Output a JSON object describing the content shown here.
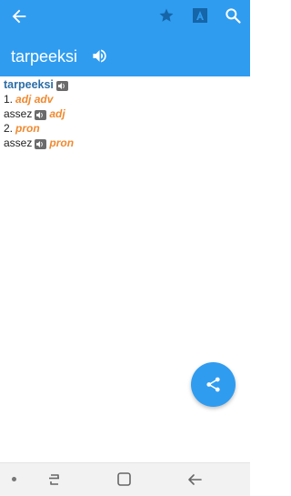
{
  "app": {
    "title": "tarpeeksi",
    "icons": {
      "back": "arrow-left-icon",
      "favorite": "star-icon",
      "font": "font-icon",
      "search": "search-icon",
      "speaker": "speaker-icon",
      "share": "share-icon"
    },
    "colors": {
      "primary": "#2f9cf0",
      "headword": "#2d6ea6",
      "pos": "#f08a30"
    }
  },
  "entry": {
    "headword": "tarpeeksi",
    "senses": [
      {
        "number": "1.",
        "pos": "adj adv",
        "translation": "assez",
        "translation_pos": "adj"
      },
      {
        "number": "2.",
        "pos": "pron",
        "translation": "assez",
        "translation_pos": "pron"
      }
    ]
  },
  "navbar": {
    "items": [
      "dot-icon",
      "recent-apps-icon",
      "home-icon",
      "back-icon"
    ]
  }
}
